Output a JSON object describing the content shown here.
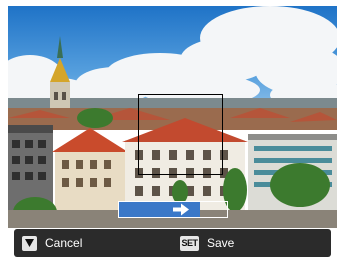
{
  "preview": {
    "scene": "city-skyline-photo",
    "progress_percent": 75,
    "arrow_icon": "arrow-right-icon"
  },
  "actions": {
    "cancel": {
      "key_icon": "down-triangle-icon",
      "label": "Cancel"
    },
    "save": {
      "key_label": "SET",
      "label": "Save"
    }
  },
  "colors": {
    "progress_fill": "#3a78c8",
    "bar_background": "#2b2b2b",
    "key_background": "#e6e6e6",
    "crop_frame": "#000000"
  }
}
